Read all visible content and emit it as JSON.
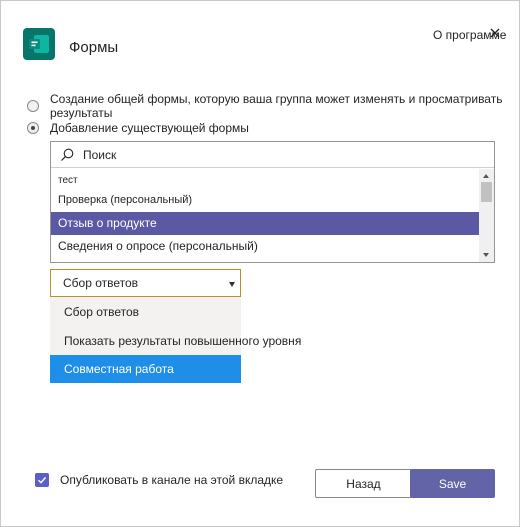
{
  "header": {
    "app_title": "Формы",
    "about_link": "О программе",
    "app_icon": "forms-app-icon",
    "close_icon": "close-icon"
  },
  "options": {
    "create_shared": "Создание общей формы, которую ваша группа может изменять и просматривать результаты",
    "add_existing": "Добавление существующей формы",
    "selected": "add_existing"
  },
  "form_picker": {
    "search_placeholder": "Поиск",
    "search_value": "",
    "items": [
      "тест",
      "Проверка (персональный)",
      "Отзыв о продукте",
      "Сведения о опросе (персональный)"
    ],
    "selected_item": "Отзыв о продукте"
  },
  "mode_select": {
    "value": "Сбор ответов",
    "options": [
      "Сбор ответов",
      "Показать результаты повышенного уровня",
      "Совместная работа"
    ],
    "highlighted": "Совместная работа"
  },
  "footer": {
    "publish_label": "Опубликовать в канале на этой вкладке",
    "publish_checked": true,
    "back_label": "Назад",
    "save_label": "Save"
  },
  "colors": {
    "accent": "#6264a7",
    "selected_row": "#5b59a3",
    "dropdown_highlight": "#1e8ee8",
    "forms_brand": "#077568"
  }
}
